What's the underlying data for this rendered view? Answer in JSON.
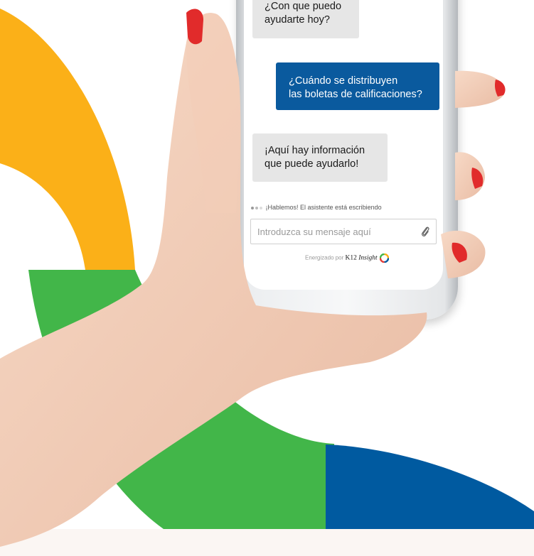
{
  "chat": {
    "messages": [
      {
        "sender": "bot",
        "text": "¿Con que puedo\nayudarte hoy?"
      },
      {
        "sender": "user",
        "text": "¿Cuándo se distribuyen\nlas boletas de calificaciones?"
      },
      {
        "sender": "bot",
        "text": "¡Aquí hay información\nque puede ayudarlo!"
      }
    ],
    "typing_status": "¡Hablemos! El asistente está escribiendo",
    "input_placeholder": "Introduzca su mensaje aquí",
    "powered_by_prefix": "Energizado por",
    "brand_k12": "K12",
    "brand_insight": "Insight"
  },
  "icons": {
    "attach": "paperclip-icon",
    "brand_logo": "k12-insight-logo-icon"
  },
  "colors": {
    "yellow": "#FBB018",
    "green": "#42B649",
    "blue": "#005AA0",
    "footer_band": "#FBF6F3",
    "user_bubble": "#0A5A9E",
    "bot_bubble": "#E6E6E6"
  }
}
